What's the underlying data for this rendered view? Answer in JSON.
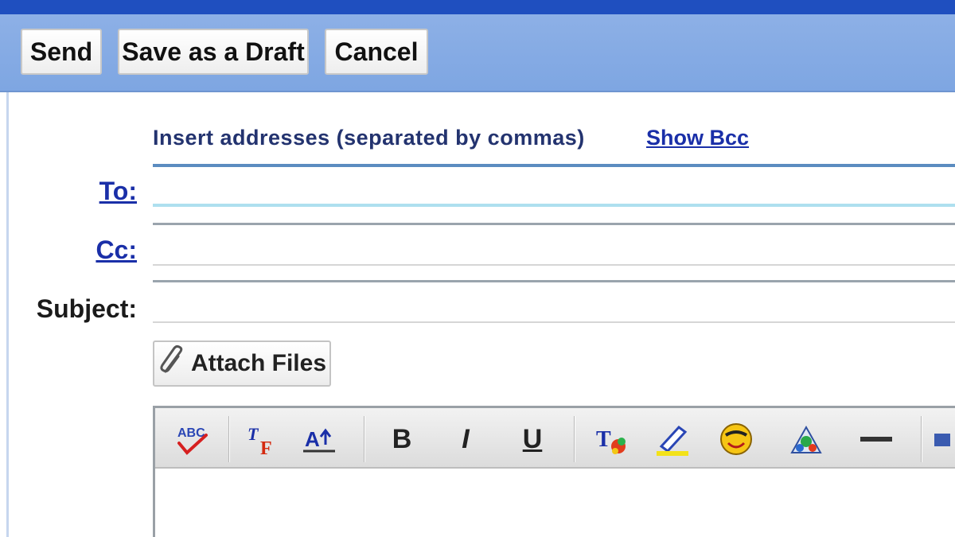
{
  "toolbar": {
    "send_label": "Send",
    "save_draft_label": "Save as a Draft",
    "cancel_label": "Cancel"
  },
  "compose": {
    "address_hint": "Insert addresses (separated by commas)",
    "show_bcc_label": "Show Bcc",
    "to_label": "To:",
    "cc_label": "Cc:",
    "subject_label": "Subject:",
    "to_value": "",
    "cc_value": "",
    "subject_value": "",
    "attach_label": "Attach Files"
  },
  "format_toolbar": {
    "bold_label": "B",
    "italic_label": "I",
    "underline_label": "U"
  },
  "colors": {
    "toolbar_band": "#8db0e6",
    "top_strip": "#1f4fbf",
    "link": "#1a2fa8",
    "active_field_border": "#5b8cc0"
  },
  "icons": [
    "paperclip-icon",
    "spellcheck-icon",
    "font-face-icon",
    "font-size-icon",
    "text-color-icon",
    "highlight-icon",
    "emoticon-icon",
    "insert-image-icon",
    "horizontal-rule-icon"
  ]
}
